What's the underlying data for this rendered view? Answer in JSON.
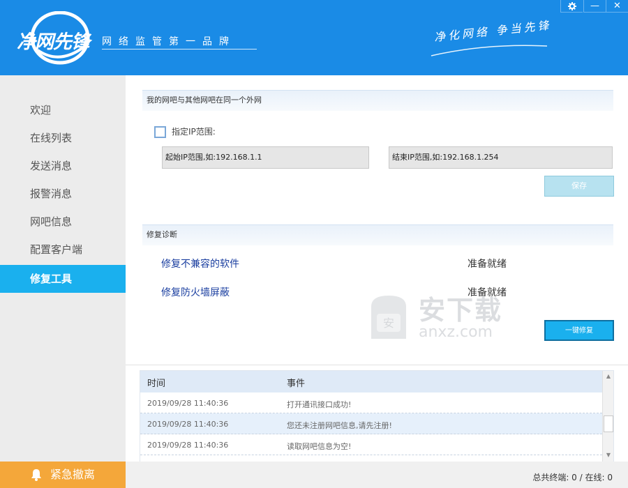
{
  "header": {
    "logo_text": "净网先锋",
    "slogan": "网络监管第一品牌",
    "tagline": "净化网络 争当先锋"
  },
  "window_buttons": {
    "settings_icon": "gear-icon",
    "minimize_label": "—",
    "close_label": "✕"
  },
  "sidebar": {
    "items": [
      {
        "label": "欢迎",
        "active": false
      },
      {
        "label": "在线列表",
        "active": false
      },
      {
        "label": "发送消息",
        "active": false
      },
      {
        "label": "报警消息",
        "active": false
      },
      {
        "label": "网吧信息",
        "active": false
      },
      {
        "label": "配置客户端",
        "active": false
      },
      {
        "label": "修复工具",
        "active": true
      }
    ],
    "emergency_label": "紧急撤离"
  },
  "network_section": {
    "title": "我的网吧与其他网吧在同一个外网",
    "checkbox_label": "指定IP范围:",
    "checkbox_checked": false,
    "ip_start_placeholder": "起始IP范围,如:192.168.1.1",
    "ip_end_placeholder": "结束IP范围,如:192.168.1.254",
    "save_label": "保存"
  },
  "repair_section": {
    "title": "修复诊断",
    "items": [
      {
        "label": "修复不兼容的软件",
        "status": "准备就绪"
      },
      {
        "label": "修复防火墙屏蔽",
        "status": "准备就绪"
      }
    ],
    "repair_all_label": "一键修复"
  },
  "log": {
    "columns": [
      "时间",
      "事件"
    ],
    "rows": [
      {
        "time": "2019/09/28 11:40:36",
        "event": "打开通讯接口成功!"
      },
      {
        "time": "2019/09/28 11:40:36",
        "event": "您还未注册网吧信息,请先注册!"
      },
      {
        "time": "2019/09/28 11:40:36",
        "event": "读取网吧信息为空!"
      }
    ]
  },
  "status": {
    "text": "总共终端: 0 / 在线: 0"
  },
  "watermark": {
    "title": "安下载",
    "subtitle": "anxz.com"
  },
  "colors": {
    "header_blue": "#1a8be6",
    "active_nav": "#1ab0ee",
    "emergency": "#f4a73a"
  }
}
